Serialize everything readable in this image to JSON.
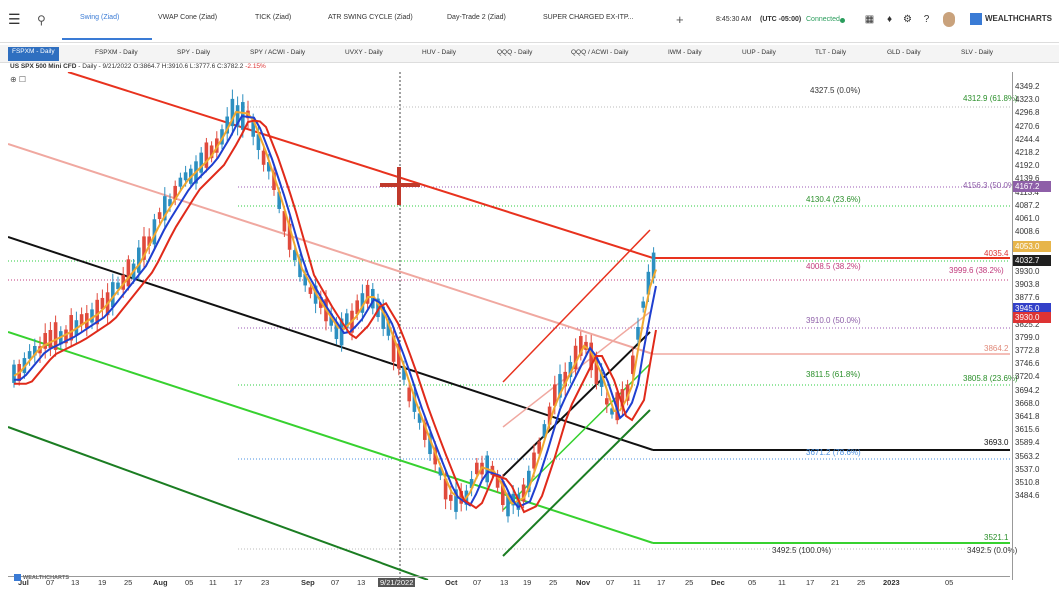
{
  "topbar": {
    "tabs": [
      "Swing (Ziad)",
      "VWAP Cone (Ziad)",
      "TICK (Ziad)",
      "ATR SWING CYCLE (Ziad)",
      "Day-Trade 2 (Ziad)",
      "SUPER CHARGED EX-ITP..."
    ],
    "time": "8:45:30 AM",
    "timezone": "(UTC -05:00)",
    "connection": "Connected",
    "logo": "WEALTHCHARTS"
  },
  "symbols": [
    "FSPXM - Daily",
    "FSPXM - Daily",
    "SPY - Daily",
    "SPY / ACWI - Daily",
    "UVXY - Daily",
    "HUV - Daily",
    "QQQ - Daily",
    "QQQ / ACWI - Daily",
    "IWM - Daily",
    "UUP - Daily",
    "TLT - Daily",
    "GLD - Daily",
    "SLV - Daily"
  ],
  "info": {
    "name": "US SPX 500 Mini CFD",
    "sep": " - Daily - 9/21/2022 O:3864.7 H:3910.6 L:3777.6 C:3782.2 ",
    "change": "-2.15%"
  },
  "y_axis": [
    "4349.2",
    "4323.0",
    "4296.8",
    "4270.6",
    "4244.4",
    "4218.2",
    "4192.0",
    "4139.6",
    "4113.4",
    "4087.2",
    "4061.0",
    "4008.6",
    "3982.4",
    "3956.2",
    "3930.0",
    "3903.8",
    "3877.6",
    "3851.4",
    "3825.2",
    "3799.0",
    "3772.8",
    "3746.6",
    "3720.4",
    "3694.2",
    "3668.0",
    "3641.8",
    "3615.6",
    "3589.4",
    "3563.2",
    "3537.0",
    "3510.8",
    "3484.6"
  ],
  "price_boxes": [
    {
      "label": "4167.2",
      "color": "#8e5fa8"
    },
    {
      "label": "4053.0",
      "color": "#e7b54a"
    },
    {
      "label": "4032.7",
      "color": "#1f1f1f"
    },
    {
      "label": "3945.0",
      "color": "#3340c8"
    },
    {
      "label": "3930.0",
      "color": "#d33"
    }
  ],
  "x_axis": [
    "Jul",
    "07",
    "13",
    "19",
    "25",
    "Aug",
    "05",
    "11",
    "17",
    "23",
    "Sep",
    "07",
    "13",
    "9/21/2022",
    "Oct",
    "07",
    "13",
    "19",
    "25",
    "Nov",
    "07",
    "11",
    "17",
    "25",
    "Dec",
    "05",
    "11",
    "17",
    "21",
    "25",
    "2023",
    "05"
  ],
  "levels": {
    "l1": "4327.5 (0.0%)",
    "l2": "4312.9 (61.8%)",
    "l3": "4156.3 (50.0%)",
    "l4": "4130.4 (23.6%)",
    "l5": "4035.4",
    "l6": "4008.5 (38.2%)",
    "l7": "3999.6 (38.2%)",
    "l8": "3910.0 (50.0%)",
    "l9": "3864.2",
    "l10": "3811.5 (61.8%)",
    "l11": "3805.8 (23.6%)",
    "l12": "3693.0",
    "l13": "3671.2 (78.6%)",
    "l14": "3521.1",
    "l15": "3492.5 (100.0%)",
    "l16": "3492.5 (0.0%)"
  },
  "footer_logo": "WEALTHCHARTS",
  "colors": {
    "accent": "#3a7bd5",
    "down": "#e04a3c",
    "up": "#2c8fc0"
  }
}
